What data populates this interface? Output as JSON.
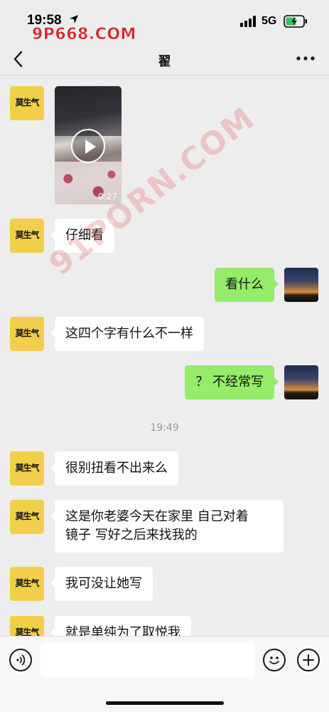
{
  "status_bar": {
    "time": "19:58",
    "watermark": "9P668.COM",
    "network": "5G",
    "icons": [
      "location-arrow-icon",
      "signal-bars-icon",
      "battery-charging-icon"
    ]
  },
  "nav": {
    "title": "翟",
    "back_icon": "chevron-left-icon",
    "more_icon": "ellipsis-icon"
  },
  "avatar_text": "莫生气",
  "video": {
    "duration": "0:27"
  },
  "watermark_diagonal": "91PORN.COM",
  "messages": [
    {
      "side": "left",
      "text": "仔细看"
    },
    {
      "side": "right",
      "text": "看什么"
    },
    {
      "side": "left",
      "text": "这四个字有什么不一样"
    },
    {
      "side": "right",
      "text": "？ 不经常写"
    },
    {
      "side": "left",
      "text": "很别扭看不出来么"
    },
    {
      "side": "left",
      "text_line1": "这是你老婆今天在家里 自己对着",
      "text_line2": "镜子 写好之后来找我的"
    },
    {
      "side": "left",
      "text": "我可没让她写"
    },
    {
      "side": "left",
      "text": "就是单纯为了取悦我"
    }
  ],
  "timestamp": "19:49",
  "colors": {
    "background": "#ededed",
    "outgoing_bubble": "#95ec69",
    "incoming_bubble": "#ffffff",
    "watermark_red": "#d7262d"
  }
}
